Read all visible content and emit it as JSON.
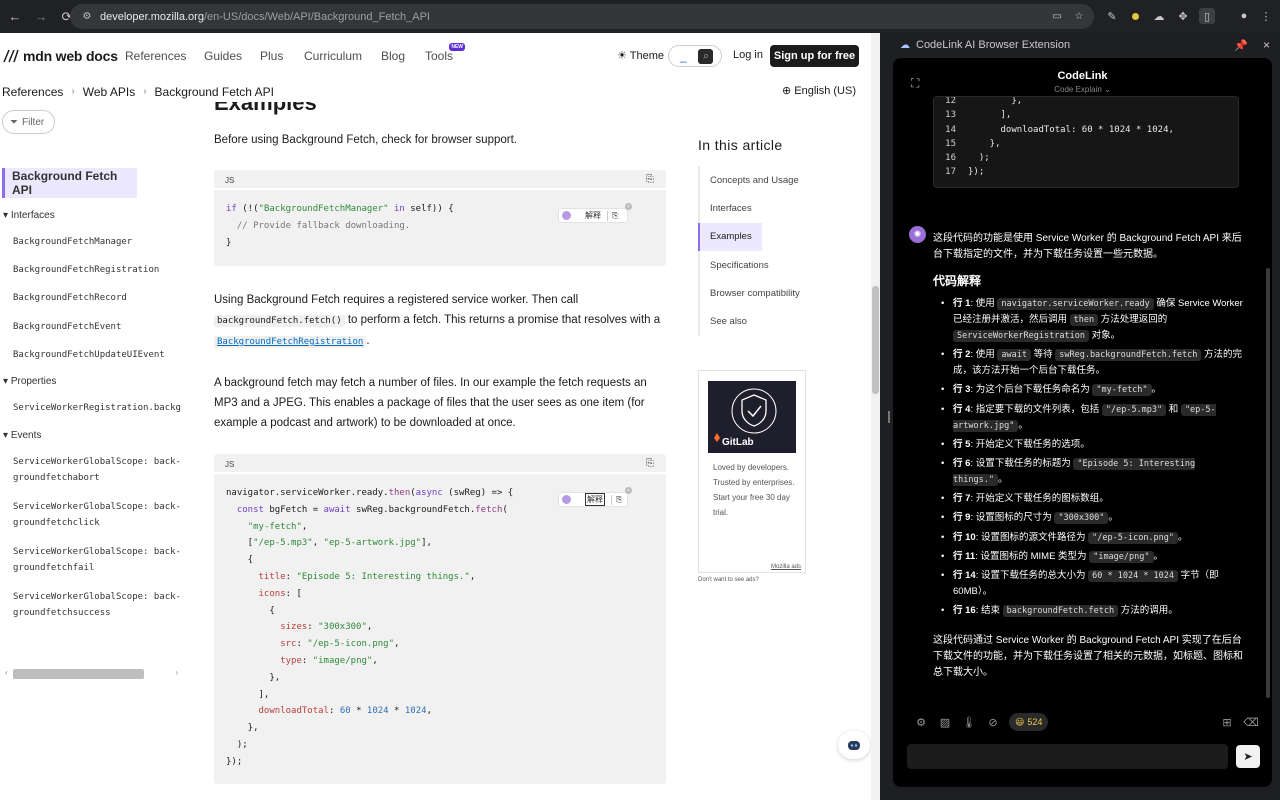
{
  "browser": {
    "url_host": "developer.mozilla.org",
    "url_path": "/en-US/docs/Web/API/Background_Fetch_API"
  },
  "mdn": {
    "logo": "mdn web docs",
    "nav": [
      "References",
      "Guides",
      "Plus",
      "Curriculum",
      "Blog",
      "Tools"
    ],
    "new_badge": "NEW",
    "theme": "Theme",
    "login": "Log in",
    "signup": "Sign up for free",
    "breadcrumb": [
      "References",
      "Web APIs",
      "Background Fetch API"
    ],
    "language": "English (US)",
    "filter": "Filter",
    "sidebar": {
      "current": "Background Fetch API",
      "groups": [
        {
          "label": "Interfaces",
          "items": [
            "BackgroundFetchManager",
            "BackgroundFetchRegistration",
            "BackgroundFetchRecord",
            "BackgroundFetchEvent",
            "BackgroundFetchUpdateUIEvent"
          ]
        },
        {
          "label": "Properties",
          "items": [
            "ServiceWorkerRegistration.backgrou"
          ]
        },
        {
          "label": "Events",
          "items": [
            "ServiceWorkerGlobalScope: back-\ngroundfetchabort",
            "ServiceWorkerGlobalScope: back-\ngroundfetchclick",
            "ServiceWorkerGlobalScope: back-\ngroundfetchfail",
            "ServiceWorkerGlobalScope: back-\ngroundfetchsuccess"
          ]
        }
      ]
    },
    "heading": "Examples",
    "p1": "Before using Background Fetch, check for browser support.",
    "code_lang": "JS",
    "chip_label": "解释",
    "p2_a": "Using Background Fetch requires a registered service worker. Then call",
    "p2_code": "backgroundFetch.fetch()",
    "p2_b": " to perform a fetch. This returns a promise that resolves with a",
    "p2_link": "BackgroundFetchRegistration",
    "p2_end": ".",
    "p3": "A background fetch may fetch a number of files. In our example the fetch requests an MP3 and a JPEG. This enables a package of files that the user sees as one item (for example a podcast and artwork) to be downloaded at once.",
    "toc_title": "In this article",
    "toc": [
      "Concepts and Usage",
      "Interfaces",
      "Examples",
      "Specifications",
      "Browser compatibility",
      "See also"
    ],
    "ad_brand": "GitLab",
    "ad_text": "Loved by developers. Trusted by enterprises. Start your free 30 day trial.",
    "ad_by": "Mozilla ads",
    "no_ads": "Don't want to see ads?"
  },
  "panel": {
    "title": "CodeLink AI Browser Extension",
    "app_title": "CodeLink",
    "app_sub": "Code Explain",
    "intro": "这段代码的功能是使用 Service Worker 的 Background Fetch API 来后台下载指定的文件，并为下载任务设置一些元数据。",
    "section": "代码解释",
    "summary": "这段代码通过 Service Worker 的 Background Fetch API 实现了在后台下载文件的功能，并为下载任务设置了相关的元数据，如标题、图标和总下载大小。",
    "tokens": "524"
  }
}
